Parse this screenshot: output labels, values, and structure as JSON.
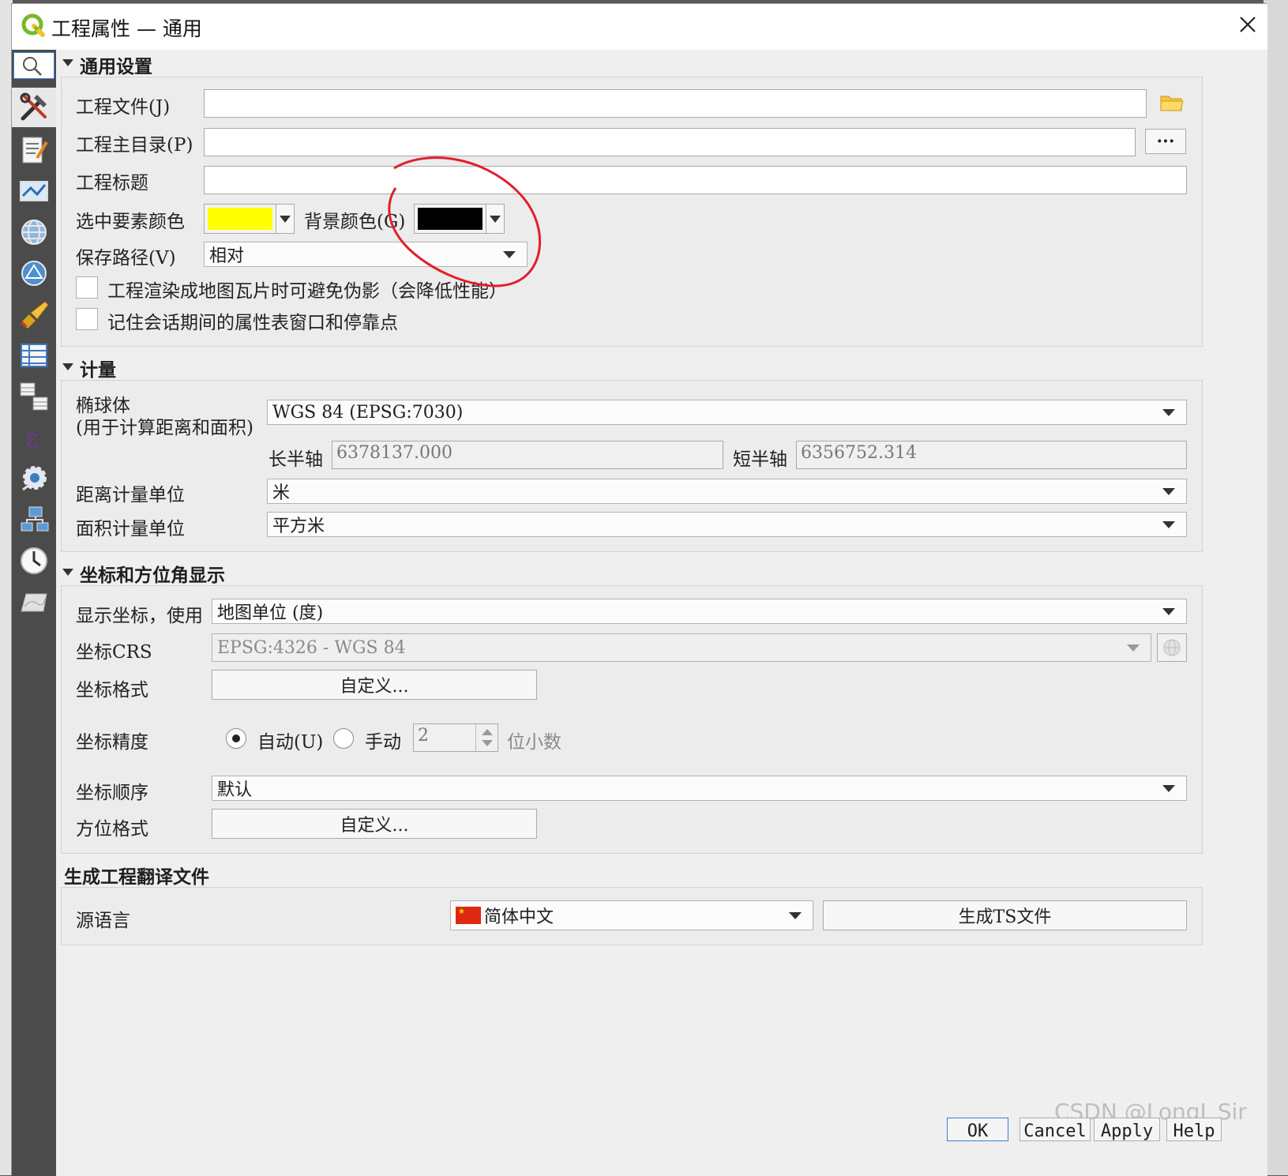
{
  "window": {
    "title": "工程属性 — 通用"
  },
  "sections": {
    "general": {
      "title": "通用设置",
      "project_file_label": "工程文件(J)",
      "project_file_value": "",
      "project_home_label": "工程主目录(P)",
      "project_home_value": "",
      "browse_label": "···",
      "project_title_label": "工程标题",
      "project_title_value": "",
      "selection_color_label": "选中要素颜色",
      "selection_color": "#ffff00",
      "background_color_label": "背景颜色(G)",
      "background_color": "#000000",
      "save_paths_label": "保存路径(V)",
      "save_paths_value": "相对",
      "avoid_artifacts_label": "工程渲染成地图瓦片时可避免伪影（会降低性能）",
      "avoid_artifacts_checked": false,
      "remember_attr_label": "记住会话期间的属性表窗口和停靠点",
      "remember_attr_checked": false
    },
    "measurements": {
      "title": "计量",
      "ellipsoid_label_1": "椭球体",
      "ellipsoid_label_2": "(用于计算距离和面积)",
      "ellipsoid_value": "WGS 84 (EPSG:7030)",
      "semi_major_label": "长半轴",
      "semi_major_value": "6378137.000",
      "semi_minor_label": "短半轴",
      "semi_minor_value": "6356752.314",
      "distance_units_label": "距离计量单位",
      "distance_units_value": "米",
      "area_units_label": "面积计量单位",
      "area_units_value": "平方米"
    },
    "coordinates": {
      "title": "坐标和方位角显示",
      "display_using_label": "显示坐标，使用",
      "display_using_value": "地图单位 (度)",
      "crs_label": "坐标CRS",
      "crs_value": "EPSG:4326 - WGS 84",
      "format_label": "坐标格式",
      "customize_label": "自定义...",
      "precision_label": "坐标精度",
      "auto_label": "自动(U)",
      "auto_selected": true,
      "manual_label": "手动",
      "manual_value": "2",
      "decimals_label": "位小数",
      "order_label": "坐标顺序",
      "order_value": "默认",
      "bearing_label": "方位格式",
      "bearing_customize_label": "自定义..."
    },
    "translation": {
      "title": "生成工程翻译文件",
      "source_lang_label": "源语言",
      "source_lang_value": "简体中文",
      "generate_ts_label": "生成TS文件"
    }
  },
  "buttons": {
    "ok": "OK",
    "cancel": "Cancel",
    "apply": "Apply",
    "help": "Help"
  },
  "sidebar": {
    "icons": [
      "search-icon",
      "general-tools-icon",
      "metadata-icon",
      "view-settings-icon",
      "crs-globe-icon",
      "transformations-icon",
      "default-styles-icon",
      "data-sources-icon",
      "relations-icon",
      "variables-icon",
      "macros-icon",
      "qgis-server-icon",
      "temporal-icon",
      "terrain-icon"
    ]
  },
  "watermark": "CSDN @LongJ_Sir",
  "colors": {
    "annotation_red": "#e0202a",
    "sidebar_bg": "#4b4b4b",
    "focus_blue": "#3c7ed6"
  }
}
